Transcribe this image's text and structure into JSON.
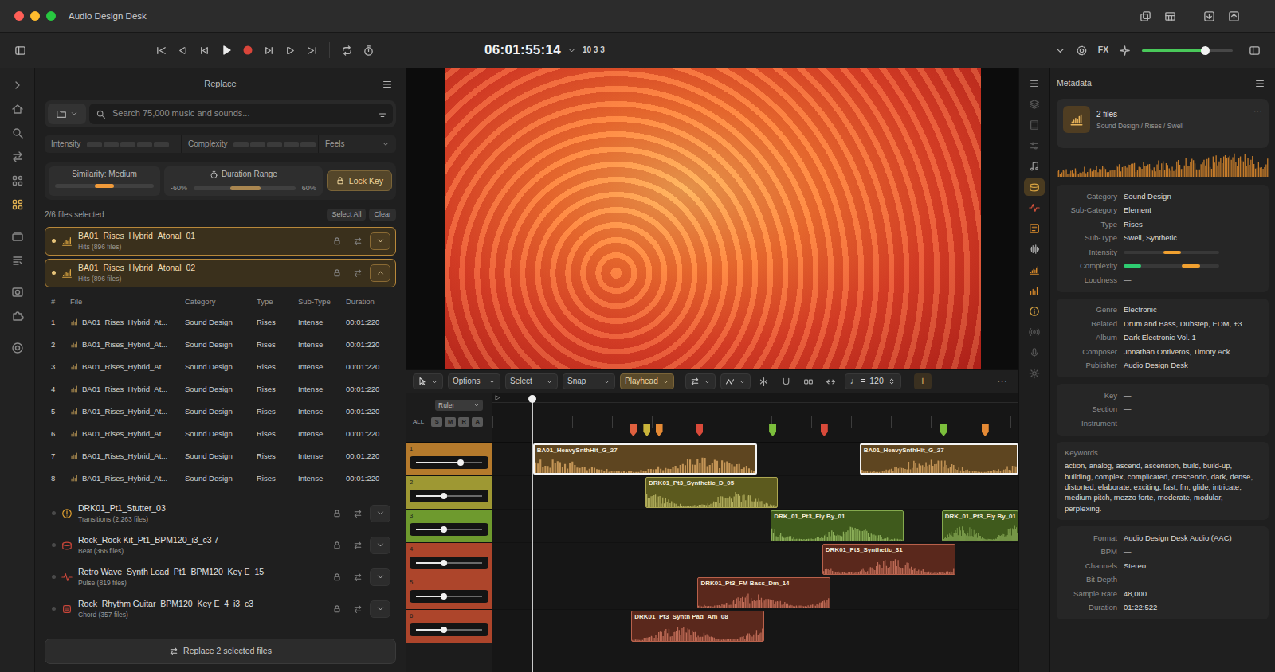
{
  "window": {
    "title": "Audio Design Desk"
  },
  "transport": {
    "timecode": "06:01:55:14",
    "position": "10 3 3",
    "fx": "FX",
    "master_volume": 0.7
  },
  "left_rail": [
    {
      "selected": false
    },
    {
      "selected": false
    },
    {
      "selected": false
    },
    {
      "selected": false
    },
    {
      "selected": false
    },
    {
      "selected": true
    },
    {
      "selected": false
    },
    {
      "selected": false
    },
    {
      "selected": false
    },
    {
      "selected": false
    },
    {
      "selected": false
    }
  ],
  "right_rail": [
    {
      "selected": false,
      "color": "#9a9a9a"
    },
    {
      "selected": false,
      "color": "#555555"
    },
    {
      "selected": false,
      "color": "#555555"
    },
    {
      "selected": false,
      "color": "#555555"
    },
    {
      "selected": false,
      "color": "#9a9a9a"
    },
    {
      "selected": true,
      "color": "#d9a441"
    },
    {
      "selected": false,
      "color": "#d0503a"
    },
    {
      "selected": false,
      "color": "#d98a2b"
    },
    {
      "selected": false,
      "color": "#a8a8a8"
    },
    {
      "selected": false,
      "color": "#d98a2b"
    },
    {
      "selected": false,
      "color": "#d98a2b"
    },
    {
      "selected": false,
      "color": "#d9a441"
    },
    {
      "selected": false,
      "color": "#555555"
    },
    {
      "selected": false,
      "color": "#555555"
    },
    {
      "selected": false,
      "color": "#555555"
    }
  ],
  "replace": {
    "title": "Replace",
    "search": {
      "placeholder": "Search 75,000 music and sounds..."
    },
    "filters": [
      {
        "label": "Intensity",
        "level": 0
      },
      {
        "label": "Complexity",
        "level": 0
      }
    ],
    "feels": "Feels",
    "similarity": {
      "label": "Similarity: Medium",
      "level": 0.5
    },
    "duration": {
      "label": "Duration Range",
      "min": "-60%",
      "max": "60%",
      "low": 0.36,
      "high": 0.66
    },
    "lock_key": "Lock Key",
    "selection": {
      "count": "2/6 files selected",
      "select_all": "Select All",
      "clear": "Clear"
    },
    "groups": [
      {
        "name": "BA01_Rises_Hybrid_Atonal_01",
        "sub": "Hits (896 files)",
        "selected": true,
        "expanded": false,
        "color": "#d9a441"
      },
      {
        "name": "BA01_Rises_Hybrid_Atonal_02",
        "sub": "Hits (896 files)",
        "selected": true,
        "expanded": true,
        "color": "#d9a441"
      },
      {
        "name": "DRK01_Pt1_Stutter_03",
        "sub": "Transitions (2,263 files)",
        "selected": false,
        "expanded": false,
        "color": "#e0a030"
      },
      {
        "name": "Rock_Rock Kit_Pt1_BPM120_i3_c3 7",
        "sub": "Beat (366 files)",
        "selected": false,
        "expanded": false,
        "color": "#c8463a"
      },
      {
        "name": "Retro Wave_Synth Lead_Pt1_BPM120_Key E_15",
        "sub": "Pulse (819 files)",
        "selected": false,
        "expanded": false,
        "color": "#c8463a"
      },
      {
        "name": "Rock_Rhythm Guitar_BPM120_Key E_4_i3_c3",
        "sub": "Chord (357 files)",
        "selected": false,
        "expanded": false,
        "color": "#c8463a"
      }
    ],
    "table": {
      "columns": [
        "#",
        "File",
        "Category",
        "Type",
        "Sub-Type",
        "Duration"
      ],
      "rows": [
        [
          "1",
          "BA01_Rises_Hybrid_At...",
          "Sound Design",
          "Rises",
          "Intense",
          "00:01:220"
        ],
        [
          "2",
          "BA01_Rises_Hybrid_At...",
          "Sound Design",
          "Rises",
          "Intense",
          "00:01:220"
        ],
        [
          "3",
          "BA01_Rises_Hybrid_At...",
          "Sound Design",
          "Rises",
          "Intense",
          "00:01:220"
        ],
        [
          "4",
          "BA01_Rises_Hybrid_At...",
          "Sound Design",
          "Rises",
          "Intense",
          "00:01:220"
        ],
        [
          "5",
          "BA01_Rises_Hybrid_At...",
          "Sound Design",
          "Rises",
          "Intense",
          "00:01:220"
        ],
        [
          "6",
          "BA01_Rises_Hybrid_At...",
          "Sound Design",
          "Rises",
          "Intense",
          "00:01:220"
        ],
        [
          "7",
          "BA01_Rises_Hybrid_At...",
          "Sound Design",
          "Rises",
          "Intense",
          "00:01:220"
        ],
        [
          "8",
          "BA01_Rises_Hybrid_At...",
          "Sound Design",
          "Rises",
          "Intense",
          "00:01:220"
        ]
      ]
    },
    "action": "Replace 2 selected files"
  },
  "timeline": {
    "tools": [
      {
        "label": "Options",
        "selected": false
      },
      {
        "label": "Select",
        "selected": false
      },
      {
        "label": "Snap",
        "selected": false
      },
      {
        "label": "Playhead",
        "selected": true
      }
    ],
    "tempo": {
      "prefix": "♩ =",
      "value": "120"
    },
    "add": "+",
    "more": "⋯",
    "ruler": "Ruler",
    "all": "ALL",
    "modes": [
      {
        "label": "S"
      },
      {
        "label": "M"
      },
      {
        "label": "R"
      },
      {
        "label": "A"
      }
    ],
    "playhead": 0.075,
    "markers": [
      {
        "at": 0.267,
        "color": "#e0603f"
      },
      {
        "at": 0.293,
        "color": "#c9b43a"
      },
      {
        "at": 0.316,
        "color": "#e58a35"
      },
      {
        "at": 0.393,
        "color": "#d94a3a"
      },
      {
        "at": 0.532,
        "color": "#7cbf3c"
      },
      {
        "at": 0.63,
        "color": "#d94a3a"
      },
      {
        "at": 0.857,
        "color": "#7cbf3c"
      },
      {
        "at": 0.936,
        "color": "#e58a35"
      }
    ],
    "tracks": [
      {
        "number": "1",
        "color": "#b57a2c",
        "clip_color": "#5e4520",
        "volume": 0.68,
        "clips": [
          {
            "name": "BA01_HeavySnthHit_G_27",
            "start": 0.077,
            "end": 0.503,
            "selected": true
          },
          {
            "name": "BA01_HeavySnthHit_G_27",
            "start": 0.698,
            "end": 1.0,
            "selected": true
          }
        ]
      },
      {
        "number": "2",
        "color": "#9e9833",
        "clip_color": "#5c5a1e",
        "volume": 0.42,
        "clips": [
          {
            "name": "DRK01_Pt3_Synthetic_D_05",
            "start": 0.291,
            "end": 0.543,
            "selected": false
          }
        ]
      },
      {
        "number": "3",
        "color": "#6e9a2e",
        "clip_color": "#3f5a1c",
        "volume": 0.42,
        "clips": [
          {
            "name": "DRK_01_Pt3_Fly By_01",
            "start": 0.529,
            "end": 0.782,
            "selected": false
          },
          {
            "name": "DRK_01_Pt3_Fly By_01",
            "start": 0.854,
            "end": 1.0,
            "selected": false
          }
        ]
      },
      {
        "number": "4",
        "color": "#ad452b",
        "clip_color": "#5a281c",
        "volume": 0.42,
        "clips": [
          {
            "name": "DRK01_Pt3_Synthetic_31",
            "start": 0.627,
            "end": 0.88,
            "selected": false
          }
        ]
      },
      {
        "number": "5",
        "color": "#ad452b",
        "clip_color": "#5a281c",
        "volume": 0.42,
        "clips": [
          {
            "name": "DRK01_Pt3_FM Bass_Dm_14",
            "start": 0.39,
            "end": 0.643,
            "selected": false
          }
        ]
      },
      {
        "number": "6",
        "color": "#ad452b",
        "clip_color": "#5a281c",
        "volume": 0.42,
        "clips": [
          {
            "name": "DRK01_Pt3_Synth Pad_Am_08",
            "start": 0.264,
            "end": 0.517,
            "selected": false
          }
        ]
      }
    ]
  },
  "metadata": {
    "title": "Metadata",
    "summary": {
      "count": "2 files",
      "path": "Sound Design / Rises / Swell",
      "more": "⋯"
    },
    "sections": [
      {
        "kind": "fields",
        "rows": [
          {
            "kind": "text",
            "label": "Category",
            "value": "Sound Design"
          },
          {
            "kind": "text",
            "label": "Sub-Category",
            "value": "Element"
          },
          {
            "kind": "text",
            "label": "Type",
            "value": "Rises"
          },
          {
            "kind": "text",
            "label": "Sub-Type",
            "value": "Swell, Synthetic"
          },
          {
            "kind": "meter",
            "label": "Intensity",
            "marks": [
              {
                "from": 0.42,
                "to": 0.6,
                "color": "#f0a030"
              }
            ]
          },
          {
            "kind": "meter",
            "label": "Complexity",
            "marks": [
              {
                "from": 0.0,
                "to": 0.18,
                "color": "#2ecc71"
              },
              {
                "from": 0.61,
                "to": 0.8,
                "color": "#f0a030"
              }
            ]
          },
          {
            "kind": "text",
            "label": "Loudness",
            "value": "—"
          }
        ]
      },
      {
        "kind": "fields",
        "rows": [
          {
            "kind": "text",
            "label": "Genre",
            "value": "Electronic"
          },
          {
            "kind": "text",
            "label": "Related",
            "value": "Drum and Bass, Dubstep, EDM, +3"
          },
          {
            "kind": "text",
            "label": "Album",
            "value": "Dark Electronic Vol. 1"
          },
          {
            "kind": "text",
            "label": "Composer",
            "value": "Jonathan Ontiveros, Timoty Ack..."
          },
          {
            "kind": "text",
            "label": "Publisher",
            "value": "Audio Design Desk"
          }
        ]
      },
      {
        "kind": "fields",
        "rows": [
          {
            "kind": "text",
            "label": "Key",
            "value": "—"
          },
          {
            "kind": "text",
            "label": "Section",
            "value": "—"
          },
          {
            "kind": "text",
            "label": "Instrument",
            "value": "—"
          }
        ]
      },
      {
        "kind": "keywords",
        "label": "Keywords",
        "text": "action, analog, ascend, ascension, build, build-up, building, complex, complicated, crescendo, dark, dense, distorted, elaborate, exciting, fast, fm, glide, intricate, medium pitch, mezzo forte, moderate, modular, perplexing."
      },
      {
        "kind": "fields",
        "rows": [
          {
            "kind": "text",
            "label": "Format",
            "value": "Audio Design Desk Audio (AAC)"
          },
          {
            "kind": "text",
            "label": "BPM",
            "value": "—"
          },
          {
            "kind": "text",
            "label": "Channels",
            "value": "Stereo"
          },
          {
            "kind": "text",
            "label": "Bit Depth",
            "value": "—"
          },
          {
            "kind": "text",
            "label": "Sample Rate",
            "value": "48,000"
          },
          {
            "kind": "text",
            "label": "Duration",
            "value": "01:22:522"
          }
        ]
      }
    ]
  }
}
